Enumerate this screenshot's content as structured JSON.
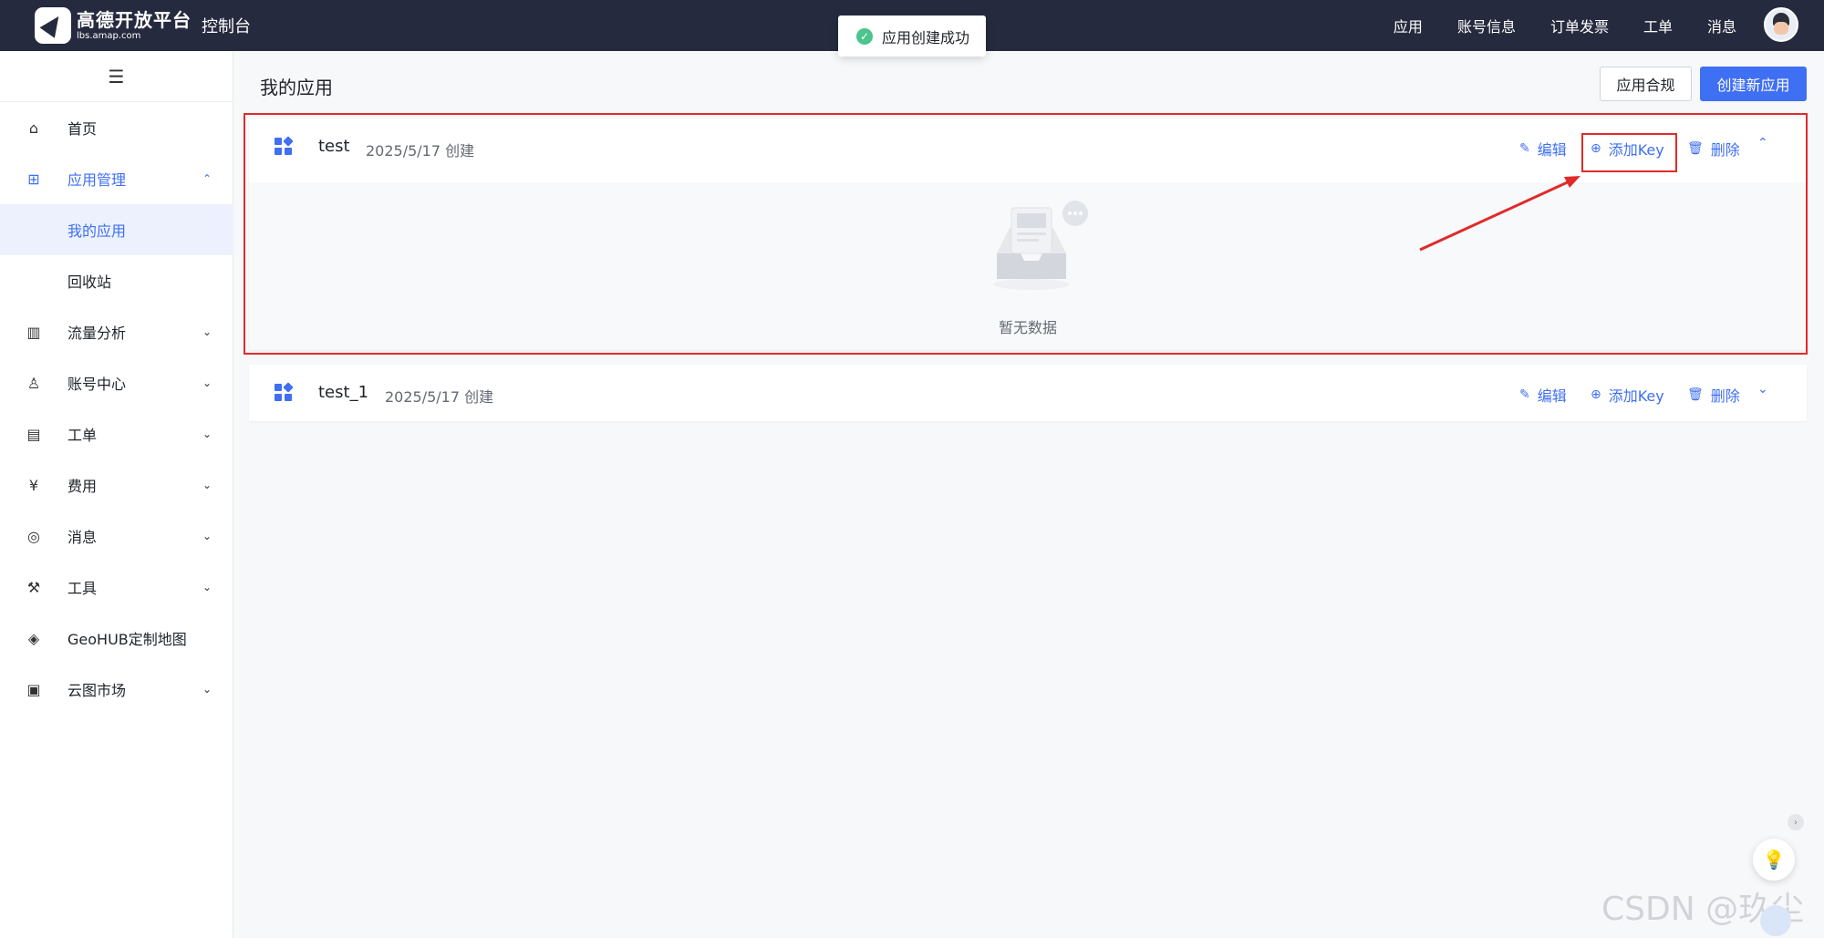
{
  "header": {
    "logo_title": "高德开放平台",
    "logo_sub": "lbs.amap.com",
    "console_label": "控制台",
    "nav": [
      "应用",
      "账号信息",
      "订单发票",
      "工单",
      "消息"
    ]
  },
  "toast": {
    "text": "应用创建成功",
    "icon": "check-circle-icon"
  },
  "sidebar": {
    "toggle_icon": "menu-icon",
    "items": [
      {
        "label": "首页",
        "icon": "home-icon",
        "chevron": ""
      },
      {
        "label": "应用管理",
        "icon": "grid-icon",
        "chevron": "⌃"
      },
      {
        "label": "我的应用",
        "icon": "",
        "chevron": ""
      },
      {
        "label": "回收站",
        "icon": "",
        "chevron": ""
      },
      {
        "label": "流量分析",
        "icon": "chart-icon",
        "chevron": "⌄"
      },
      {
        "label": "账号中心",
        "icon": "user-icon",
        "chevron": "⌄"
      },
      {
        "label": "工单",
        "icon": "ticket-icon",
        "chevron": "⌄"
      },
      {
        "label": "费用",
        "icon": "money-icon",
        "chevron": "⌄"
      },
      {
        "label": "消息",
        "icon": "message-icon",
        "chevron": "⌄"
      },
      {
        "label": "工具",
        "icon": "wrench-icon",
        "chevron": "⌄"
      },
      {
        "label": "GeoHUB定制地图",
        "icon": "layers-icon",
        "chevron": ""
      },
      {
        "label": "云图市场",
        "icon": "store-icon",
        "chevron": "⌄"
      }
    ]
  },
  "main": {
    "title": "我的应用",
    "btn_compliance": "应用合规",
    "btn_create": "创建新应用",
    "apps": [
      {
        "name": "test",
        "date": "2025/5/17 创建",
        "edit": "编辑",
        "add_key": "添加Key",
        "delete": "删除",
        "collapse": "⌃",
        "empty_text": "暂无数据"
      },
      {
        "name": "test_1",
        "date": "2025/5/17 创建",
        "edit": "编辑",
        "add_key": "添加Key",
        "delete": "删除",
        "collapse": "⌄"
      }
    ]
  },
  "watermark": "CSDN @玖尘",
  "colors": {
    "accent": "#3f6ff2",
    "topbar": "#262a3e",
    "highlight": "#e02b2b",
    "success": "#4cc48c"
  }
}
